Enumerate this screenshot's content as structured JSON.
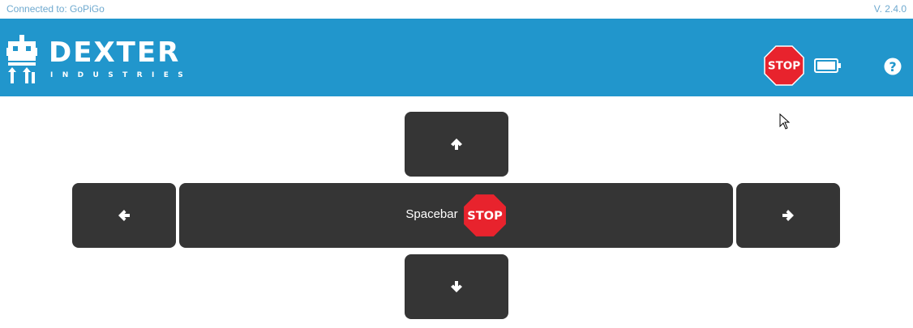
{
  "status_bar": {
    "connection_text": "Connected to: GoPiGo",
    "version_text": "V. 2.4.0"
  },
  "header": {
    "logo_word": "DEXTER",
    "logo_sub": "INDUSTRIES",
    "stop_label": "STOP",
    "battery_icon": "battery-full-icon",
    "help_icon": "question-circle-icon"
  },
  "controls": {
    "up_icon": "arrow-up-icon",
    "left_icon": "arrow-left-icon",
    "right_icon": "arrow-right-icon",
    "down_icon": "arrow-down-icon",
    "spacebar_label": "Spacebar",
    "stop_label": "STOP"
  },
  "colors": {
    "header_bg": "#2196cc",
    "key_bg": "#353535",
    "stop_red": "#e8232d",
    "status_text": "#6ea9cf"
  }
}
